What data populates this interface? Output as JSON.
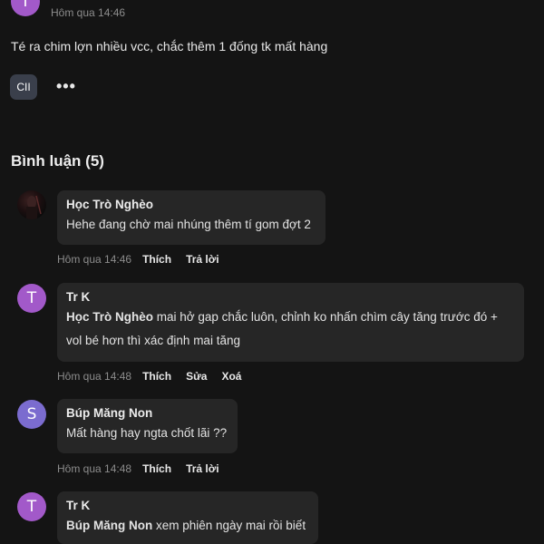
{
  "post": {
    "author_initial": "T",
    "timestamp": "Hôm qua 14:46",
    "content": "Té ra chim lợn nhiều vcc, chắc thêm 1 đống tk mất hàng",
    "tag": "CII",
    "more_icon": "•••"
  },
  "comments_header": "Bình luận (5)",
  "comments": [
    {
      "author": "Học Trò Nghèo",
      "text": "Hehe đang chờ mai nhúng thêm tí gom đợt 2",
      "time": "Hôm qua 14:46",
      "actions": [
        "Thích",
        "Trả lời"
      ]
    },
    {
      "initial": "T",
      "author": "Tr K",
      "mention": "Học Trò Nghèo",
      "text_line1": " mai hở gap chắc luôn, chỉnh ko nhấn chìm cây tăng trước đó +",
      "text_line2": "vol bé hơn thì xác định mai tăng",
      "time": "Hôm qua 14:48",
      "actions": [
        "Thích",
        "Sửa",
        "Xoá"
      ]
    },
    {
      "initial": "S",
      "author": "Búp Măng Non",
      "text": "Mất hàng hay ngta chốt lãi ??",
      "time": "Hôm qua 14:48",
      "actions": [
        "Thích",
        "Trả lời"
      ]
    },
    {
      "initial": "T",
      "author": "Tr K",
      "mention": "Búp Măng Non",
      "text": " xem phiên ngày mai rồi biết"
    }
  ]
}
